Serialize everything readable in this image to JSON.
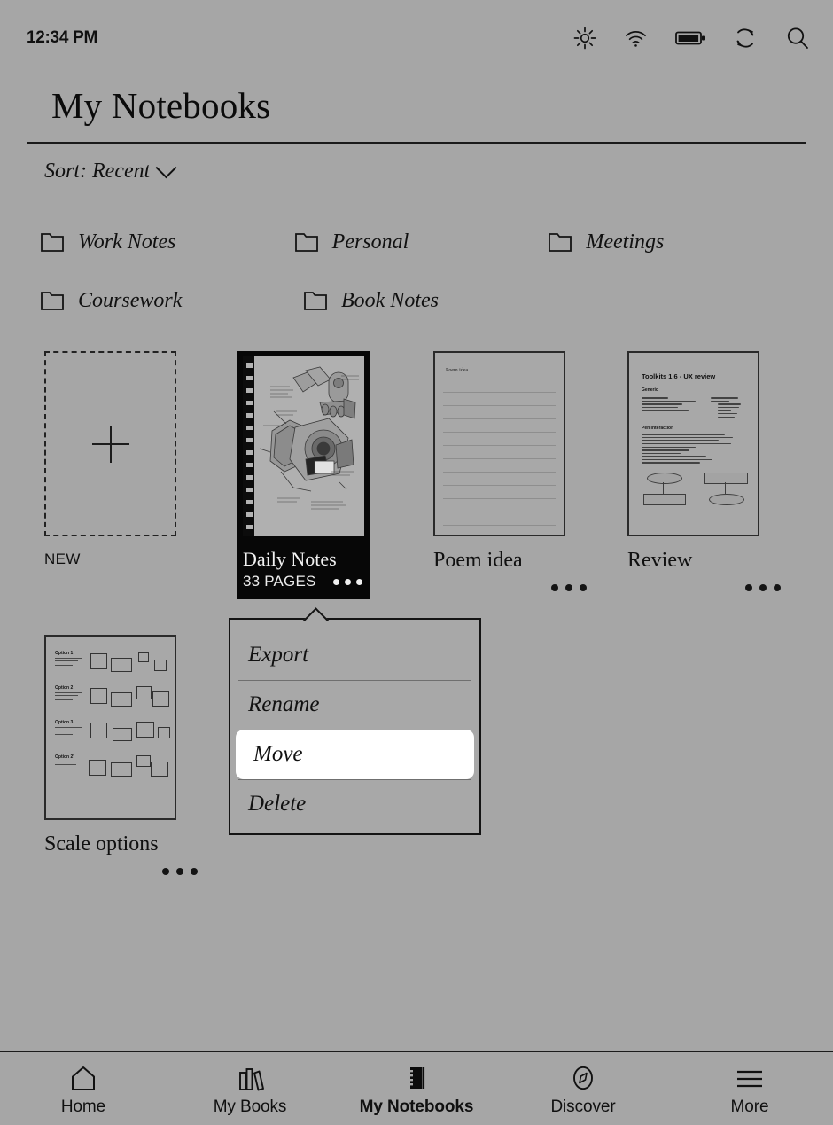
{
  "status_bar": {
    "time": "12:34 PM",
    "icons": [
      "brightness-icon",
      "wifi-icon",
      "battery-icon",
      "sync-icon",
      "search-icon"
    ]
  },
  "header": {
    "title": "My Notebooks"
  },
  "sort": {
    "label": "Sort: Recent",
    "chevron": "chevron-down-icon"
  },
  "folders": [
    {
      "name": "Work Notes"
    },
    {
      "name": "Personal"
    },
    {
      "name": "Meetings"
    },
    {
      "name": "Coursework"
    },
    {
      "name": "Book Notes"
    }
  ],
  "new_item": {
    "label": "NEW",
    "icon": "plus-icon"
  },
  "notebooks": [
    {
      "title": "Daily Notes",
      "pages": "33 PAGES",
      "selected": true,
      "thumbnail": "mechanical-sketch",
      "menu_button": "more-options-icon"
    },
    {
      "title": "Poem idea",
      "selected": false,
      "thumbnail": "lined-page",
      "thumbnail_text": "Poem idea",
      "menu_button": "more-options-icon"
    },
    {
      "title": "Review",
      "selected": false,
      "thumbnail": "ux-review-document",
      "menu_button": "more-options-icon"
    },
    {
      "title": "Scale options",
      "selected": false,
      "thumbnail": "scale-options-diagram",
      "menu_button": "more-options-icon"
    }
  ],
  "review_thumbnail": {
    "heading": "Toolkits 1.6 - UX review",
    "sections": [
      "Generic",
      "Pen interaction"
    ]
  },
  "scale_thumbnail": {
    "options": [
      "Option 1",
      "Option 2",
      "Option 3",
      "Option 2'"
    ]
  },
  "context_menu": {
    "items": [
      {
        "label": "Export",
        "selected": false
      },
      {
        "label": "Rename",
        "selected": false
      },
      {
        "label": "Move",
        "selected": true
      },
      {
        "label": "Delete",
        "selected": false
      }
    ]
  },
  "bottom_nav": [
    {
      "label": "Home",
      "icon": "home-icon",
      "active": false
    },
    {
      "label": "My Books",
      "icon": "books-icon",
      "active": false
    },
    {
      "label": "My Notebooks",
      "icon": "notebook-icon",
      "active": true
    },
    {
      "label": "Discover",
      "icon": "compass-icon",
      "active": false
    },
    {
      "label": "More",
      "icon": "hamburger-icon",
      "active": false
    }
  ],
  "colors": {
    "background": "#a6a6a6",
    "ink": "#111111",
    "selected_card": "#070707",
    "highlight": "#ffffff"
  }
}
